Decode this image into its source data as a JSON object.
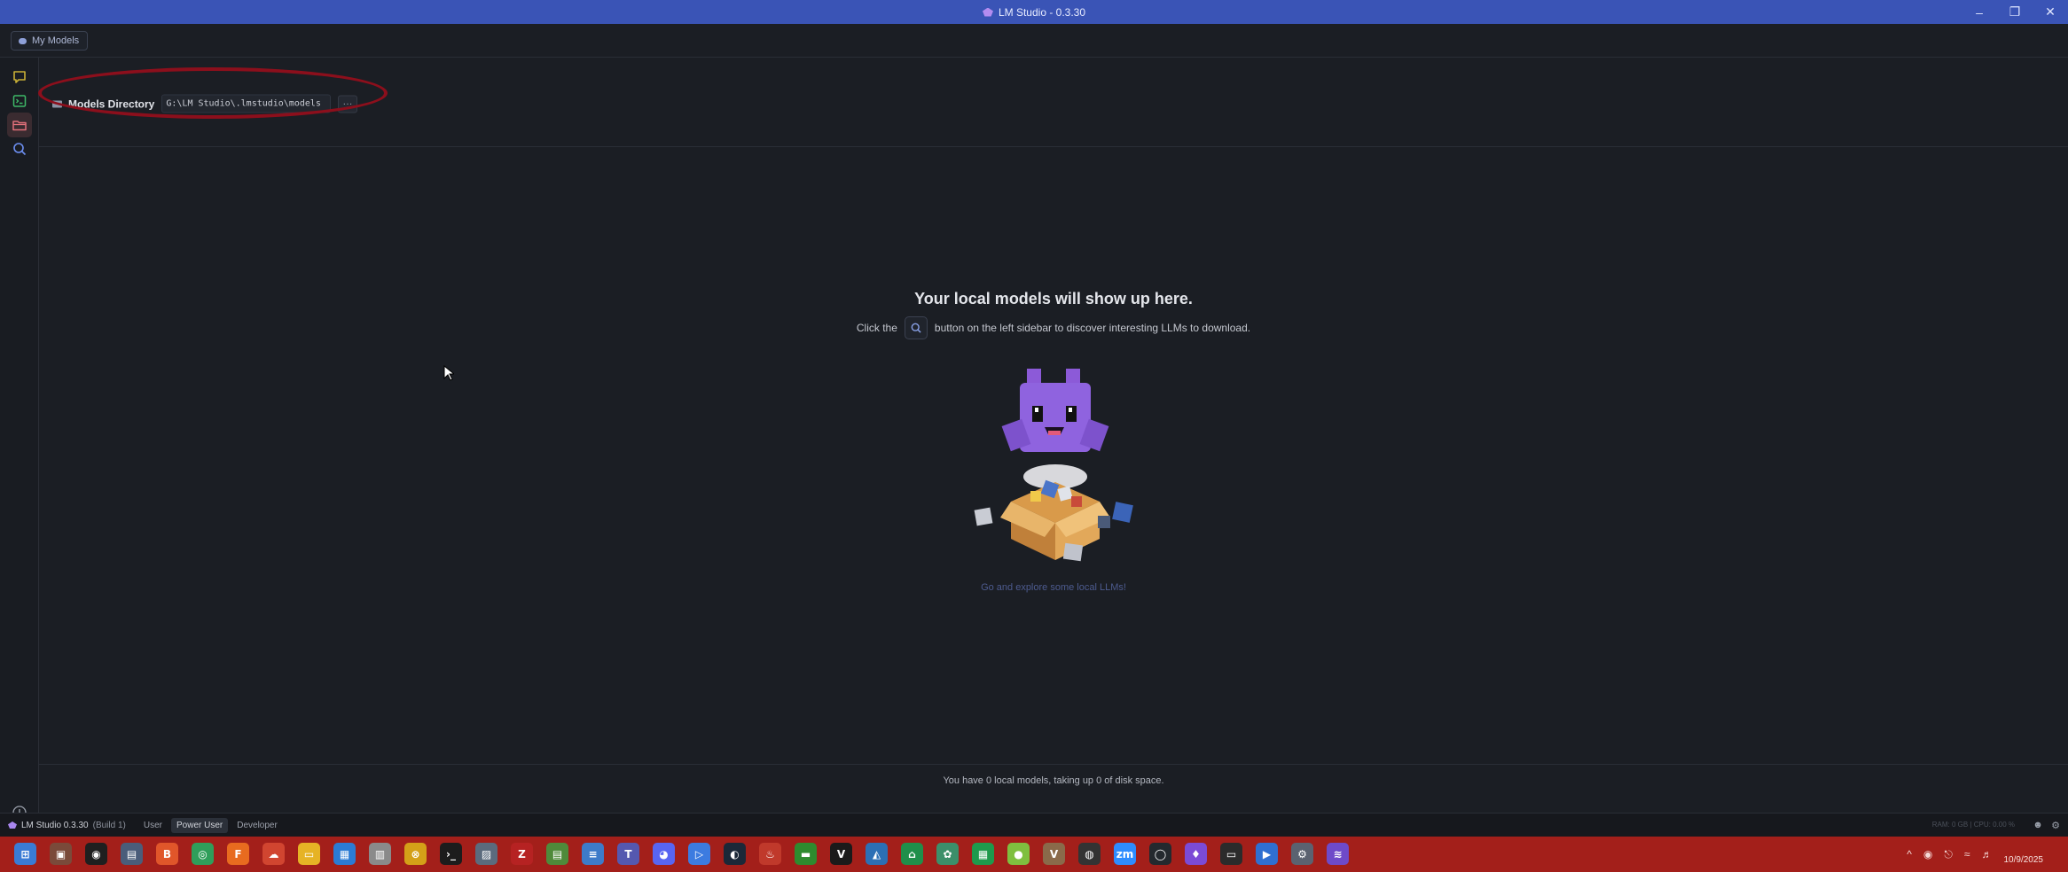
{
  "window": {
    "title": "LM Studio - 0.3.30",
    "controls": [
      "minimize",
      "restore",
      "close"
    ]
  },
  "topbar": {
    "my_models_label": "My Models"
  },
  "sidebar": {
    "items": [
      {
        "name": "chat",
        "icon": "chat-bubble-icon",
        "color": "#c9b036"
      },
      {
        "name": "developer",
        "icon": "terminal-icon",
        "color": "#3eb867"
      },
      {
        "name": "my-models",
        "icon": "folder-icon",
        "color": "#e0707a",
        "active": true
      },
      {
        "name": "discover",
        "icon": "search-icon",
        "color": "#6c8ef0"
      }
    ],
    "download_icon": "download-icon"
  },
  "models_directory": {
    "label": "Models Directory",
    "path": "G:\\LM Studio\\.lmstudio\\models",
    "more_label": "···"
  },
  "empty_state": {
    "title": "Your local models will show up here.",
    "desc_before": "Click the",
    "desc_after": "button on the left sidebar to discover interesting LLMs to download.",
    "explore_link": "Go and explore some local LLMs!"
  },
  "summary": "You have 0 local models, taking up 0 of disk space.",
  "statusbar": {
    "app_label": "LM Studio 0.3.30",
    "build_label": "(Build 1)",
    "modes": [
      {
        "label": "User",
        "active": false
      },
      {
        "label": "Power User",
        "active": true
      },
      {
        "label": "Developer",
        "active": false
      }
    ],
    "stats": "RAM: 0 GB  |  CPU: 0.00 %"
  },
  "taskbar": {
    "apps": [
      {
        "name": "start",
        "color": "#3a7bd5",
        "glyph": "⊞"
      },
      {
        "name": "app-2",
        "color": "#7a4a3a",
        "glyph": "▣"
      },
      {
        "name": "app-3",
        "color": "#1f1f1f",
        "glyph": "◉"
      },
      {
        "name": "app-4",
        "color": "#4a5d7a",
        "glyph": "▤"
      },
      {
        "name": "brave",
        "color": "#e0562a",
        "glyph": "B"
      },
      {
        "name": "chrome",
        "color": "#2f9e5a",
        "glyph": "◎"
      },
      {
        "name": "firefox",
        "color": "#e86b1f",
        "glyph": "F"
      },
      {
        "name": "app-8",
        "color": "#d14530",
        "glyph": "☁"
      },
      {
        "name": "explorer",
        "color": "#e6b325",
        "glyph": "▭"
      },
      {
        "name": "app-10",
        "color": "#2b7bd4",
        "glyph": "▦"
      },
      {
        "name": "app-11",
        "color": "#8a8a8a",
        "glyph": "▥"
      },
      {
        "name": "app-12",
        "color": "#d4a018",
        "glyph": "⊗"
      },
      {
        "name": "terminal",
        "color": "#1c1c1c",
        "glyph": "›_"
      },
      {
        "name": "app-14",
        "color": "#5b6b7d",
        "glyph": "▨"
      },
      {
        "name": "filezilla",
        "color": "#b62222",
        "glyph": "Z"
      },
      {
        "name": "app-16",
        "color": "#4f8a3a",
        "glyph": "▤"
      },
      {
        "name": "notepad",
        "color": "#3d7bc9",
        "glyph": "≡"
      },
      {
        "name": "teams",
        "color": "#5558af",
        "glyph": "T"
      },
      {
        "name": "discord",
        "color": "#5865f2",
        "glyph": "◕"
      },
      {
        "name": "app-20",
        "color": "#3c7be0",
        "glyph": "▷"
      },
      {
        "name": "steam",
        "color": "#1b2838",
        "glyph": "◐"
      },
      {
        "name": "app-22",
        "color": "#c0392b",
        "glyph": "♨"
      },
      {
        "name": "app-23",
        "color": "#2e8b2e",
        "glyph": "▬"
      },
      {
        "name": "app-24",
        "color": "#1a1a1a",
        "glyph": "V"
      },
      {
        "name": "app-25",
        "color": "#2c6fb5",
        "glyph": "◭"
      },
      {
        "name": "app-26",
        "color": "#1f8f4a",
        "glyph": "⌂"
      },
      {
        "name": "app-27",
        "color": "#3c8f6a",
        "glyph": "✿"
      },
      {
        "name": "app-28",
        "color": "#1e9a4c",
        "glyph": "▦"
      },
      {
        "name": "app-29",
        "color": "#7fbf3f",
        "glyph": "●"
      },
      {
        "name": "app-30",
        "color": "#8a6a4a",
        "glyph": "V"
      },
      {
        "name": "app-31",
        "color": "#333333",
        "glyph": "◍"
      },
      {
        "name": "zoom",
        "color": "#2d8cff",
        "glyph": "zm"
      },
      {
        "name": "github",
        "color": "#24292e",
        "glyph": "◯"
      },
      {
        "name": "app-34",
        "color": "#7b4bd6",
        "glyph": "♦"
      },
      {
        "name": "app-35",
        "color": "#2b2b2b",
        "glyph": "▭"
      },
      {
        "name": "app-36",
        "color": "#2f6fd1",
        "glyph": "▶"
      },
      {
        "name": "settings",
        "color": "#5b6270",
        "glyph": "⚙"
      },
      {
        "name": "lmstudio",
        "color": "#6e4ac9",
        "glyph": "≋"
      }
    ],
    "date": "10/9/2025"
  },
  "colors": {
    "titlebar": "#3a54b6",
    "background": "#1b1e24",
    "taskbar": "#a31f1a",
    "annotation": "#8c0f1c",
    "explore_link": "#4d5b8f"
  }
}
